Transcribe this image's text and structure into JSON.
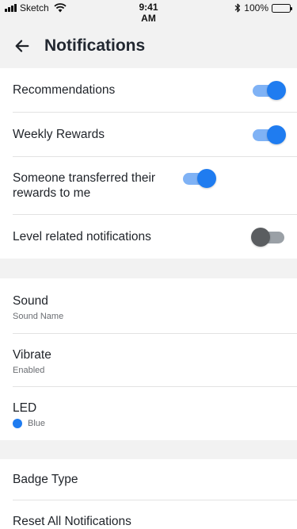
{
  "status_bar": {
    "carrier": "Sketch",
    "time_line1": "9:41",
    "time_line2": "AM",
    "battery": "100%"
  },
  "header": {
    "back_icon": "arrow-left-icon",
    "title": "Notifications"
  },
  "toggles": [
    {
      "label": "Recommendations",
      "enabled": true
    },
    {
      "label": "Weekly Rewards",
      "enabled": true
    },
    {
      "label": "Someone transferred their rewards to me",
      "enabled": true
    },
    {
      "label": "Level related notifications",
      "enabled": false
    }
  ],
  "settings": {
    "sound": {
      "label": "Sound",
      "value": "Sound Name"
    },
    "vibrate": {
      "label": "Vibrate",
      "value": "Enabled"
    },
    "led": {
      "label": "LED",
      "value": "Blue",
      "color": "#1f7cf0"
    }
  },
  "actions": {
    "badge_type": "Badge Type",
    "reset": "Reset All Notifications"
  },
  "colors": {
    "accent": "#1f7cf0",
    "accent_track": "#7fb2f5",
    "off_thumb": "#5a5d60",
    "off_track": "#9aa0a6"
  }
}
